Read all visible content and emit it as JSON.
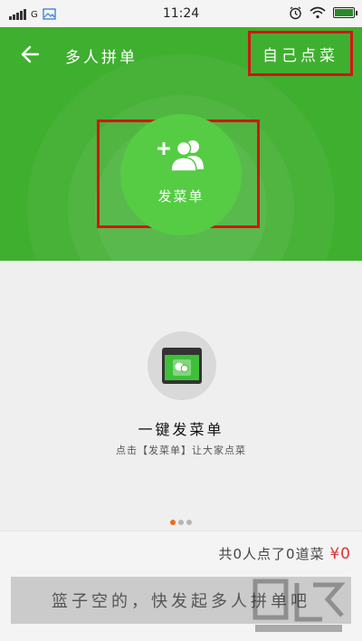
{
  "status_bar": {
    "carrier": "G",
    "time": "11:24"
  },
  "nav": {
    "title": "多人拼单",
    "self_order_label": "自己点菜"
  },
  "hero": {
    "publish_label": "发菜单",
    "plus_glyph": "+"
  },
  "promo": {
    "title": "一键发菜单",
    "subtitle": "点击【发菜单】让大家点菜",
    "carousel_count": 3,
    "carousel_active_index": 0
  },
  "summary": {
    "text": "共0人点了0道菜",
    "price": "¥0"
  },
  "cta": {
    "label": "篮子空的，快发起多人拼单吧"
  },
  "colors": {
    "primary_green": "#3faf2f",
    "button_green": "#55cc44",
    "highlight_red": "#d41414",
    "price_red": "#e03232",
    "active_dot": "#f06a1a"
  },
  "icons": {
    "back": "arrow-left",
    "publish": "add-users",
    "promo": "phone-chat"
  }
}
